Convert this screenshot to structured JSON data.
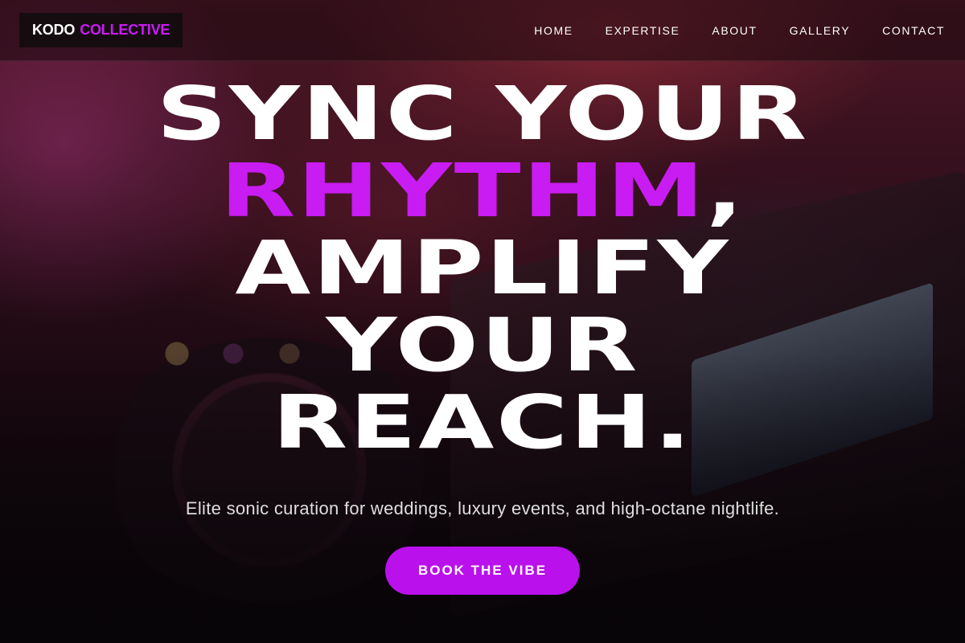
{
  "brand": {
    "name_primary": "KODO",
    "name_accent": "COLLECTIVE",
    "accent_color": "#c81cf2"
  },
  "nav": {
    "items": [
      {
        "label": "HOME"
      },
      {
        "label": "EXPERTISE"
      },
      {
        "label": "ABOUT"
      },
      {
        "label": "GALLERY"
      },
      {
        "label": "CONTACT"
      }
    ]
  },
  "hero": {
    "line1": "SYNC YOUR",
    "line2_accent": "RHYTHM",
    "line2_suffix": ",",
    "line3": "AMPLIFY",
    "line4": "YOUR",
    "line5": "REACH.",
    "subtitle": "Elite sonic curation for weddings, luxury events, and high-octane nightlife.",
    "cta_label": "BOOK THE VIBE",
    "cta_color": "#b910ec"
  }
}
